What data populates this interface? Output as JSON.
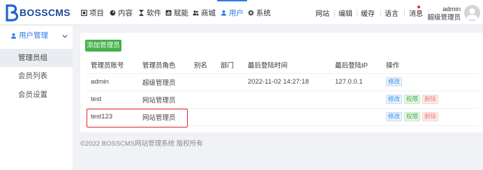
{
  "header": {
    "logo_text": "BOSSCMS",
    "nav": [
      {
        "label": "项目",
        "icon": "grid-icon"
      },
      {
        "label": "内容",
        "icon": "content-icon"
      },
      {
        "label": "软件",
        "icon": "hourglass-icon"
      },
      {
        "label": "赋能",
        "icon": "bar-chart-icon"
      },
      {
        "label": "商城",
        "icon": "group-icon"
      },
      {
        "label": "用户",
        "icon": "user-icon",
        "active": true
      },
      {
        "label": "系统",
        "icon": "gear-icon"
      }
    ],
    "tools": [
      {
        "label": "网站"
      },
      {
        "label": "编辑"
      },
      {
        "label": "缓存"
      },
      {
        "label": "语言"
      },
      {
        "label": "消息",
        "has_notification": true
      }
    ],
    "user": {
      "name": "admin",
      "role": "超级管理员",
      "icon": "avatar-icon"
    }
  },
  "sidebar": {
    "group": {
      "label": "用户管理",
      "icon": "user-icon",
      "expanded": true
    },
    "items": [
      {
        "label": "管理员组",
        "active": true
      },
      {
        "label": "会员列表"
      },
      {
        "label": "会员设置"
      }
    ]
  },
  "main": {
    "add_button_label": "添加管理员",
    "table": {
      "columns": [
        "管理员账号",
        "管理员角色",
        "别名",
        "部门",
        "最后登陆时间",
        "最后登陆IP",
        "操作"
      ],
      "rows": [
        {
          "account": "admin",
          "role": "超级管理员",
          "last_login_time": "2022-11-02 14:27:18",
          "last_login_ip": "127.0.0.1",
          "actions": [
            "修改"
          ]
        },
        {
          "account": "test",
          "role": "网站管理员",
          "actions": [
            "修改",
            "权限",
            "删除"
          ]
        },
        {
          "account": "test123",
          "role": "网站管理员",
          "actions": [
            "修改",
            "权限",
            "删除"
          ]
        }
      ]
    }
  },
  "footer": {
    "copyright": "©2022 BOSSCMS网站管理系统 版权所有"
  },
  "colors": {
    "brand": "#1c4a9c",
    "accent": "#2b7de9",
    "add_button": "#43b14b",
    "edit": "#3a8ee6",
    "permission": "#3cae47",
    "delete": "#ef7b7b",
    "notification_dot": "#f5222d",
    "highlight_box": "#e02424"
  }
}
